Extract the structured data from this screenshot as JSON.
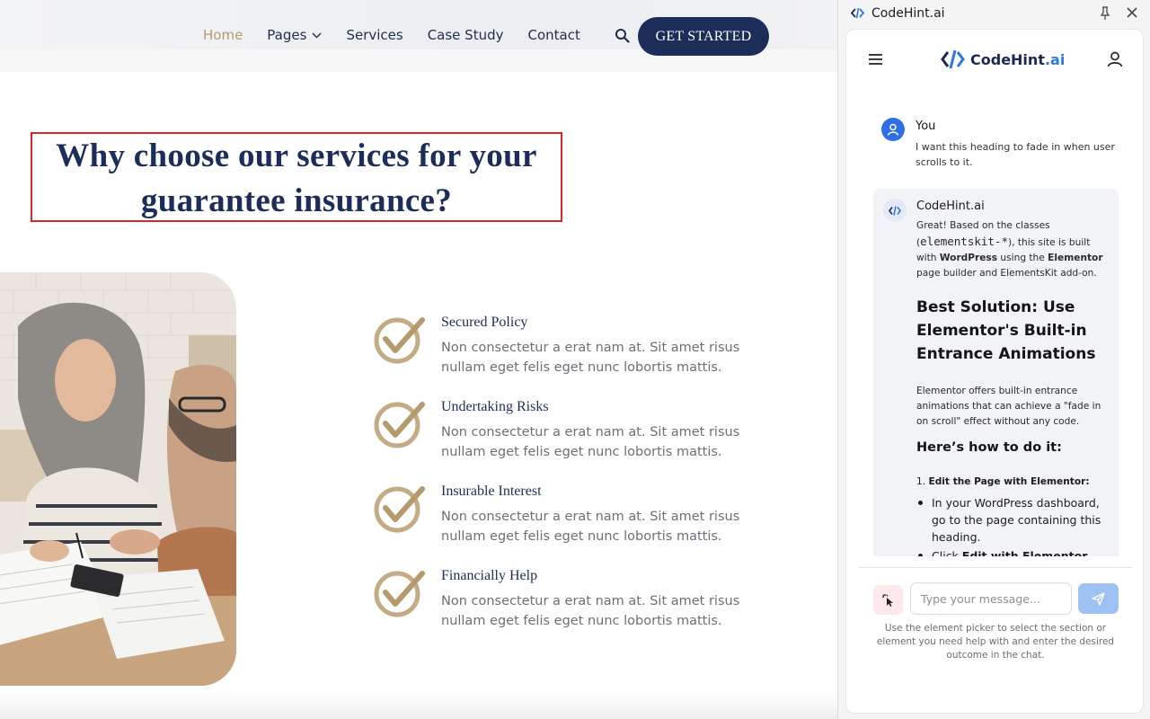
{
  "site": {
    "nav": {
      "items": [
        {
          "label": "Home",
          "active": true
        },
        {
          "label": "Pages",
          "has_dropdown": true
        },
        {
          "label": "Services"
        },
        {
          "label": "Case Study"
        },
        {
          "label": "Contact"
        }
      ],
      "search_icon": "search-icon",
      "cta_label": "GET STARTED"
    },
    "heading_line1": "Why choose our services for your",
    "heading_line2": "guarantee insurance?",
    "features": [
      {
        "title": "Secured Policy",
        "desc": "Non consectetur a erat nam at. Sit amet risus nullam eget felis eget nunc lobortis mattis."
      },
      {
        "title": "Undertaking Risks",
        "desc": "Non consectetur a erat nam at. Sit amet risus nullam eget felis eget nunc lobortis mattis."
      },
      {
        "title": "Insurable Interest",
        "desc": "Non consectetur a erat nam at. Sit amet risus nullam eget felis eget nunc lobortis mattis."
      },
      {
        "title": "Financially Help",
        "desc": "Non consectetur a erat nam at. Sit amet risus nullam eget felis eget nunc lobortis mattis."
      }
    ],
    "colors": {
      "navy": "#1b2d58",
      "gold": "#b59a6d",
      "highlight": "#d9262b"
    }
  },
  "panel": {
    "window_title": "CodeHint.ai",
    "brand_name": "CodeHint",
    "brand_suffix": ".ai",
    "user_message": {
      "author": "You",
      "text": "I want this heading to fade in when user scrolls to it."
    },
    "bot_message": {
      "author": "CodeHint.ai",
      "intro_1": "Great! Based on the classes (",
      "intro_code": "elementskit-*",
      "intro_2": "), this site is built with",
      "intro_bold_1": "WordPress",
      "intro_3": "using the",
      "intro_bold_2": "Elementor",
      "intro_4": "page builder and ElementsKit add-on.",
      "heading": "Best Solution: Use Elementor's Built-in Entrance Animations",
      "paragraph": "Elementor offers built-in entrance animations that can achieve a \"fade in on scroll\" effect without any code.",
      "subheading": "Here’s how to do it:",
      "step_number": "1.",
      "step_title": "Edit the Page with Elementor:",
      "bullet_1": "In your WordPress dashboard, go to the page containing this heading.",
      "bullet_2_prefix": "Click",
      "bullet_2_bold": "Edit with Elementor",
      "bullet_2_suffix": "."
    },
    "input_placeholder": "Type your message...",
    "hint": "Use the element picker to select the section or element you need help with and enter the desired outcome in the chat.",
    "colors": {
      "brand_blue": "#2a78e4",
      "brand_navy": "#1b2a55",
      "send": "#9fc2f4",
      "picker_bg": "#fde9e9"
    }
  }
}
